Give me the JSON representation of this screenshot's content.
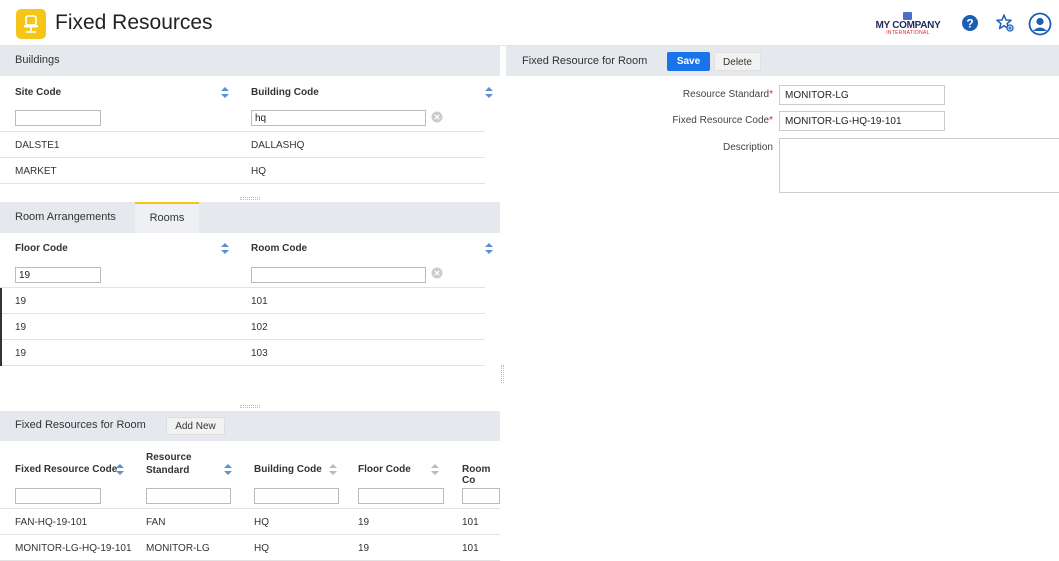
{
  "header": {
    "title": "Fixed Resources",
    "company_name": "MY COMPANY",
    "company_sub": "INTERNATIONAL"
  },
  "buildings": {
    "title": "Buildings",
    "columns": [
      "Site Code",
      "Building Code"
    ],
    "filters": [
      "",
      "hq"
    ],
    "rows": [
      [
        "DALSTE1",
        "DALLASHQ"
      ],
      [
        "MARKET",
        "HQ"
      ]
    ]
  },
  "rooms": {
    "tabs": [
      "Room Arrangements",
      "Rooms"
    ],
    "active_tab": "Rooms",
    "columns": [
      "Floor Code",
      "Room Code"
    ],
    "filters": [
      "19",
      ""
    ],
    "rows": [
      [
        "19",
        "101"
      ],
      [
        "19",
        "102"
      ],
      [
        "19",
        "103"
      ]
    ]
  },
  "fixed_resources": {
    "title": "Fixed Resources for Room",
    "add_new_label": "Add New",
    "columns": [
      "Fixed Resource Code",
      "Resource Standard",
      "Building Code",
      "Floor Code",
      "Room Co"
    ],
    "rows": [
      [
        "FAN-HQ-19-101",
        "FAN",
        "HQ",
        "19",
        "101"
      ],
      [
        "MONITOR-LG-HQ-19-101",
        "MONITOR-LG",
        "HQ",
        "19",
        "101"
      ]
    ]
  },
  "form": {
    "title": "Fixed Resource for Room",
    "save_label": "Save",
    "delete_label": "Delete",
    "resource_standard_label": "Resource Standard",
    "resource_standard_value": "MONITOR-LG",
    "fixed_resource_code_label": "Fixed Resource Code",
    "fixed_resource_code_value": "MONITOR-LG-HQ-19-101",
    "description_label": "Description",
    "required_mark": "*"
  },
  "colors": {
    "accent": "#1a73e8",
    "logo": "#f5c518",
    "panel_bar": "#e5e8ec"
  },
  "icons": [
    "chair-icon",
    "help-icon",
    "favorites-star-icon",
    "user-avatar-icon",
    "sort-icon",
    "clear-icon"
  ]
}
